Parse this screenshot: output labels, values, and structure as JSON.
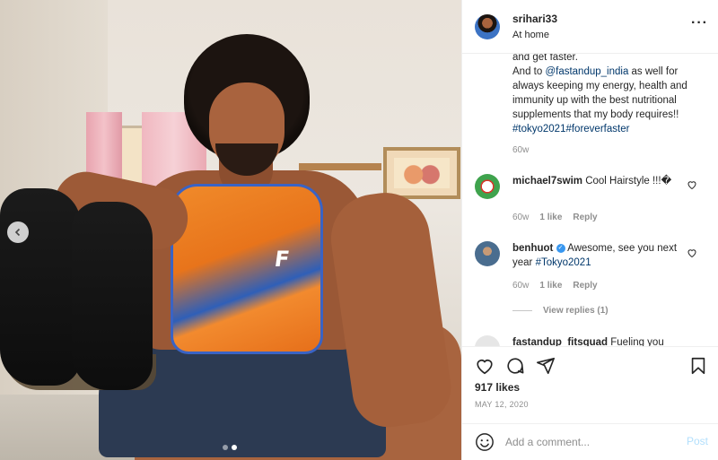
{
  "header": {
    "username": "srihari33",
    "location": "At home",
    "more_icon": "more-horizontal-icon"
  },
  "caption": {
    "line1": "and get faster.",
    "line2_pre": "And to ",
    "mention": "@fastandup_india",
    "line2_post": " as well for always keeping my energy, health and immunity up with the best nutritional supplements that my body requires!!",
    "tag1": "#tokyo2021",
    "tag2": "#foreverfaster",
    "time": "60w"
  },
  "comments": [
    {
      "username": "michael7swim",
      "text": "Cool Hairstyle !!!\u0000",
      "time": "60w",
      "likes": "1 like",
      "reply": "Reply"
    },
    {
      "username": "benhuot",
      "text_pre": "Awesome, see you next year ",
      "tag": "#Tokyo2021",
      "time": "60w",
      "likes": "1 like",
      "reply": "Reply",
      "view_replies": "View replies (1)"
    },
    {
      "username": "fastandup_fitsquad",
      "text": "Fueling you"
    }
  ],
  "actions": {
    "likes": "917 likes",
    "date": "MAY 12, 2020"
  },
  "add_comment": {
    "placeholder": "Add a comment...",
    "post_label": "Post"
  },
  "carousel": {
    "prev_icon": "chevron-left-icon",
    "slides": 2,
    "active_slide": 2
  },
  "colors": {
    "link": "#00376b",
    "muted": "#8e8e8e",
    "post_disabled": "#b2dffc",
    "verified": "#3897f0"
  }
}
